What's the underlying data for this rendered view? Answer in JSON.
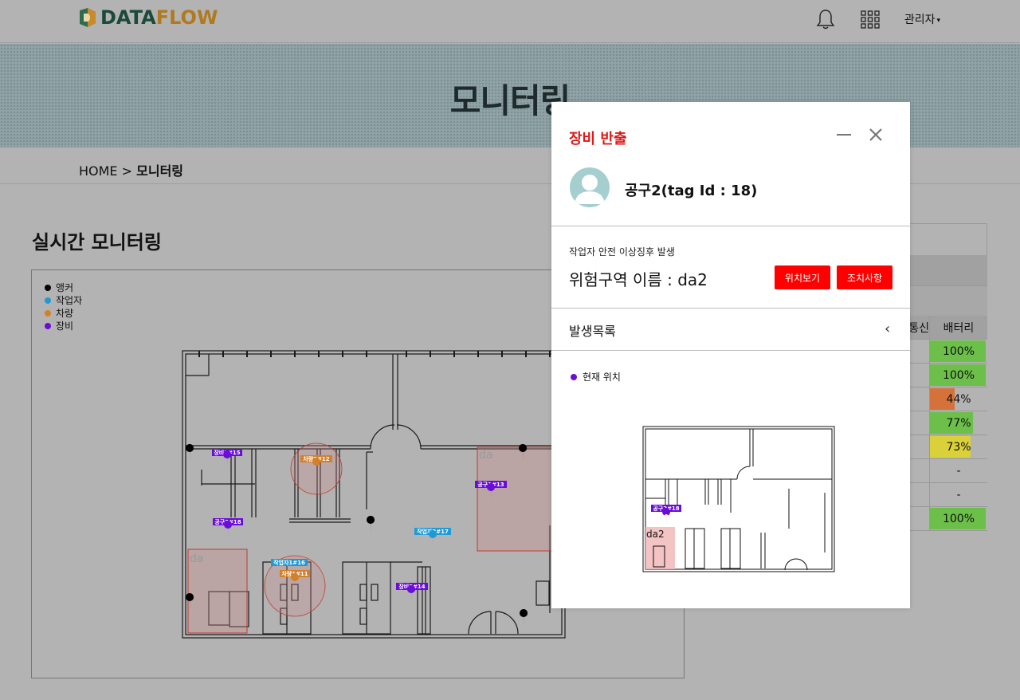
{
  "header": {
    "logo_part1": "DATA",
    "logo_part2": "FLOW",
    "admin_label": "관리자",
    "admin_caret": "▾"
  },
  "banner": {
    "title": "모니터링"
  },
  "breadcrumb": {
    "home": "HOME",
    "separator": ">",
    "current": "모니터링"
  },
  "section": {
    "title": "실시간 모니터링"
  },
  "legend": [
    {
      "label": "앵커",
      "color": "#000000"
    },
    {
      "label": "작업자",
      "color": "#1f9ad6"
    },
    {
      "label": "차량",
      "color": "#d4802a"
    },
    {
      "label": "장비",
      "color": "#6a0dd8"
    }
  ],
  "map": {
    "danger_zones": [
      "da",
      "da"
    ],
    "markers": [
      {
        "label": "장비1#15",
        "type": "equipment"
      },
      {
        "label": "차량2#12",
        "type": "vehicle"
      },
      {
        "label": "공구1#13",
        "type": "equipment"
      },
      {
        "label": "공구2#18",
        "type": "equipment"
      },
      {
        "label": "작업자2#17",
        "type": "worker"
      },
      {
        "label": "작업자1#16",
        "type": "worker"
      },
      {
        "label": "차량1#11",
        "type": "vehicle"
      },
      {
        "label": "장비2#14",
        "type": "equipment"
      }
    ]
  },
  "table": {
    "header_partial": "통신",
    "header_battery": "배터리",
    "rows": [
      {
        "battery": "100%",
        "level": 1.0,
        "color": "#6cc04a"
      },
      {
        "battery": "100%",
        "level": 1.0,
        "color": "#6cc04a"
      },
      {
        "battery": "44%",
        "level": 0.44,
        "color": "#d4723a"
      },
      {
        "battery": "77%",
        "level": 0.77,
        "color": "#6cc04a"
      },
      {
        "battery": "73%",
        "level": 0.73,
        "color": "#d9d03a"
      },
      {
        "battery": "-",
        "level": 0,
        "color": ""
      },
      {
        "battery": "-",
        "level": 0,
        "color": ""
      },
      {
        "battery": "100%",
        "level": 1.0,
        "color": "#6cc04a"
      }
    ]
  },
  "modal": {
    "title": "장비 반출",
    "tag_name": "공구2(tag Id : 18)",
    "alert_sub": "작업자 안전 이상징후 발생",
    "zone_name": "위험구역 이름 : da2",
    "btn_view_location": "위치보기",
    "btn_action": "조치사항",
    "history_label": "발생목록",
    "current_position": "현재 위치",
    "mini_marker_label": "공구2#18",
    "mini_zone_label": "da2"
  },
  "colors": {
    "accent_red": "#ff0000",
    "equipment": "#6a0dd8",
    "vehicle": "#d4802a",
    "worker": "#1f9ad6"
  }
}
